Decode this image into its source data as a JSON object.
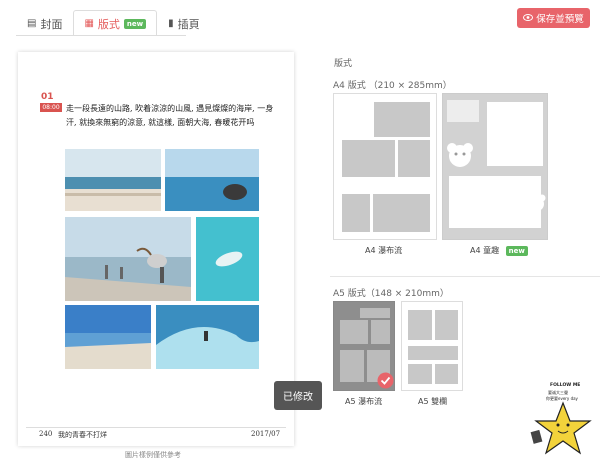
{
  "tabs": [
    {
      "label": "封面",
      "icon": "book-icon"
    },
    {
      "label": "版式",
      "icon": "grid-icon",
      "badge": "new"
    },
    {
      "label": "插頁",
      "icon": "bookmark-icon"
    }
  ],
  "save_button": "保存並預覽",
  "preview": {
    "day": "01",
    "time": "08:00",
    "text": "走一段長遠的山路, 吹着涼涼的山風, 遇見燦燦的海岸, 一身汗, 就換來無窮的涼意, 就這樣, 面朝大海, 春暖花开吗",
    "footer_page": "240",
    "footer_title": "我的青春不打烊",
    "footer_date": "2017/07",
    "caption": "圖片樣例僅供參考"
  },
  "modified_button": "已修改",
  "sidebar": {
    "title": "版式",
    "a4_title": "A4 版式 （210 × 285mm）",
    "a5_title": "A5 版式（148 × 210mm）",
    "a4_layouts": [
      {
        "label": "A4 瀑布流"
      },
      {
        "label": "A4 童趣",
        "badge": "new"
      }
    ],
    "a5_layouts": [
      {
        "label": "A5 瀑布流",
        "selected": true
      },
      {
        "label": "A5 雙欄"
      }
    ]
  },
  "mascot": {
    "lines": [
      "FOLLOW ME",
      "要诚大三聲",
      "你更要every day"
    ]
  },
  "colors": {
    "accent": "#e8646a",
    "new_badge": "#5cb85c",
    "placeholder": "#c8c8c8"
  }
}
